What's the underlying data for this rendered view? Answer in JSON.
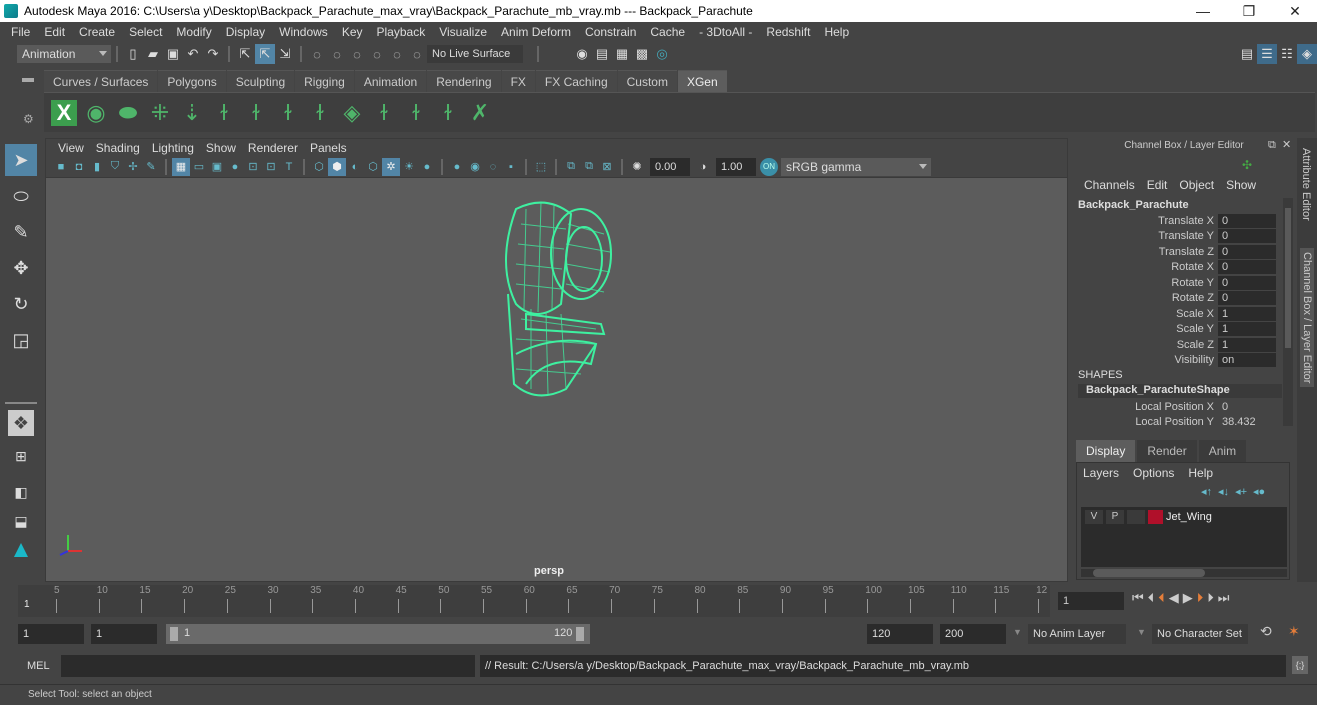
{
  "window": {
    "title": "Autodesk Maya 2016: C:\\Users\\a y\\Desktop\\Backpack_Parachute_max_vray\\Backpack_Parachute_mb_vray.mb   ---   Backpack_Parachute",
    "minimize": "—",
    "maximize": "❐",
    "close": "✕"
  },
  "menubar": [
    "File",
    "Edit",
    "Create",
    "Select",
    "Modify",
    "Display",
    "Windows",
    "Key",
    "Playback",
    "Visualize",
    "Anim Deform",
    "Constrain",
    "Cache",
    "- 3DtoAll -",
    "Redshift",
    "Help"
  ],
  "statusline": {
    "menuset": "Animation",
    "live_surface": "No Live Surface"
  },
  "shelf": {
    "tabs": [
      "Curves / Surfaces",
      "Polygons",
      "Sculpting",
      "Rigging",
      "Animation",
      "Rendering",
      "FX",
      "FX Caching",
      "Custom",
      "XGen"
    ],
    "active_tab": "XGen",
    "icons": [
      "xgen-editor-icon",
      "create-description-icon",
      "preview-description-icon",
      "add-guides-icon",
      "place-guides-icon",
      "add-guide-icon",
      "sculpt-guide-icon",
      "lock-guide-icon",
      "guide-length-icon",
      "xgen-grid-icon",
      "rebuild-guides-icon",
      "select-guides-icon",
      "guide-flip-icon",
      "delete-guide-icon"
    ]
  },
  "toolbox": [
    "select-tool-icon",
    "lasso-tool-icon",
    "paint-select-icon",
    "move-tool-icon",
    "rotate-tool-icon",
    "scale-tool-icon"
  ],
  "viewport": {
    "menu": [
      "View",
      "Shading",
      "Lighting",
      "Show",
      "Renderer",
      "Panels"
    ],
    "exposure": "0.00",
    "gamma": "1.00",
    "color_space": "sRGB gamma",
    "camera": "persp",
    "model_color": "#3ef0a0"
  },
  "channel_box": {
    "title": "Channel Box / Layer Editor",
    "menu": [
      "Channels",
      "Edit",
      "Object",
      "Show"
    ],
    "object": "Backpack_Parachute",
    "channels": [
      {
        "label": "Translate X",
        "value": "0"
      },
      {
        "label": "Translate Y",
        "value": "0"
      },
      {
        "label": "Translate Z",
        "value": "0"
      },
      {
        "label": "Rotate X",
        "value": "0"
      },
      {
        "label": "Rotate Y",
        "value": "0"
      },
      {
        "label": "Rotate Z",
        "value": "0"
      },
      {
        "label": "Scale X",
        "value": "1"
      },
      {
        "label": "Scale Y",
        "value": "1"
      },
      {
        "label": "Scale Z",
        "value": "1"
      },
      {
        "label": "Visibility",
        "value": "on"
      }
    ],
    "shapes_header": "SHAPES",
    "shape_name": "Backpack_ParachuteShape",
    "shape_channels": [
      {
        "label": "Local Position X",
        "value": "0"
      },
      {
        "label": "Local Position Y",
        "value": "38.432"
      }
    ]
  },
  "side_tabs": [
    "Attribute Editor",
    "Channel Box / Layer Editor"
  ],
  "layer_editor": {
    "tabs": [
      "Display",
      "Render",
      "Anim"
    ],
    "active_tab": "Display",
    "menu": [
      "Layers",
      "Options",
      "Help"
    ],
    "layers": [
      {
        "v": "V",
        "p": "P",
        "name": "Jet_Wing",
        "color": "#b0102a"
      }
    ]
  },
  "timeline": {
    "ticks": [
      "5",
      "10",
      "15",
      "20",
      "25",
      "30",
      "35",
      "40",
      "45",
      "50",
      "55",
      "60",
      "65",
      "70",
      "75",
      "80",
      "85",
      "90",
      "95",
      "100",
      "105",
      "110",
      "115",
      "12"
    ],
    "current_marker": "1",
    "current_frame": "1"
  },
  "range": {
    "start": "1",
    "playback_start": "1",
    "slider_start": "1",
    "slider_end": "120",
    "playback_end": "120",
    "end": "200",
    "anim_layer": "No Anim Layer",
    "character_set": "No Character Set"
  },
  "command": {
    "lang": "MEL",
    "result": "// Result: C:/Users/a y/Desktop/Backpack_Parachute_max_vray/Backpack_Parachute_mb_vray.mb"
  },
  "help_line": "Select Tool: select an object"
}
